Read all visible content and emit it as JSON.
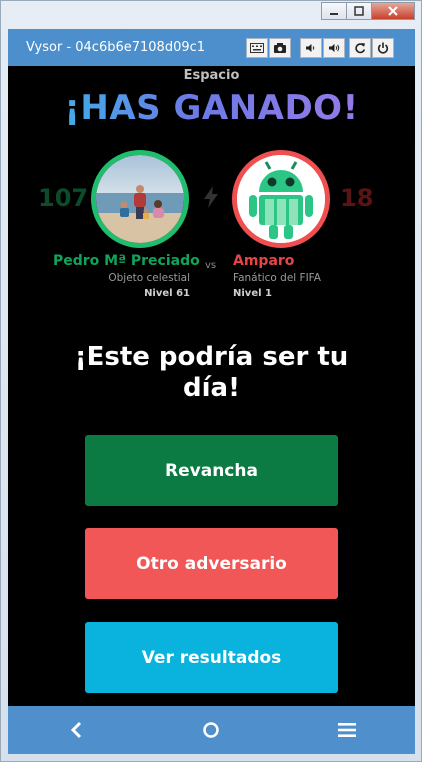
{
  "window": {
    "app_title": "Vysor - 04c6b6e7108d09c1"
  },
  "game": {
    "category": "Espacio",
    "result_title": "¡HAS GANADO!",
    "player": {
      "name": "Pedro Mª Preciado",
      "score": "107",
      "subtitle": "Objeto celestial",
      "level": "Nivel 61"
    },
    "versus_label": "vs",
    "opponent": {
      "name": "Amparo",
      "score": "18",
      "subtitle": "Fanático del FIFA",
      "level": "Nivel 1"
    },
    "message": "¡Este podría ser tu día!",
    "buttons": {
      "rematch": "Revancha",
      "other_opponent": "Otro adversario",
      "view_results": "Ver resultados"
    }
  },
  "colors": {
    "toolbar": "#4d8fcd",
    "winner_green": "#1fbd6d",
    "loser_red": "#ef4f4f",
    "rematch_bg": "#0b7a43",
    "other_bg": "#f15756",
    "results_bg": "#09b3dd"
  }
}
